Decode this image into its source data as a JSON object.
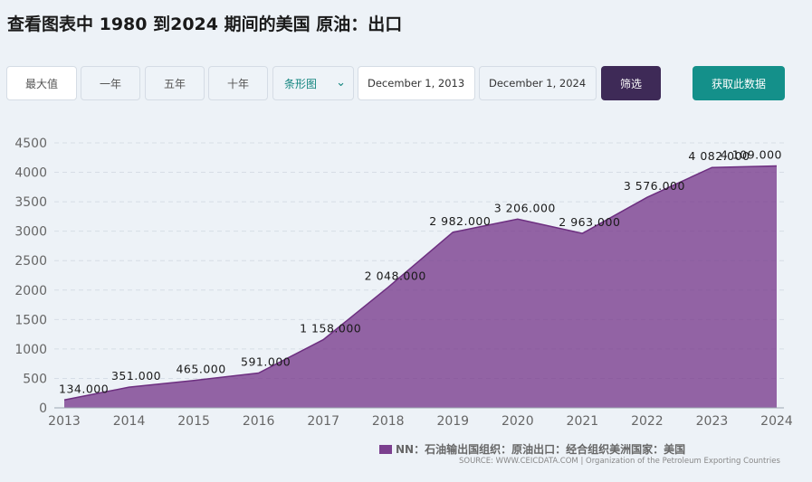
{
  "header": {
    "title": "查看图表中 1980 到2024 期间的美国 原油：出口"
  },
  "toolbar": {
    "range_buttons": [
      "最大值",
      "一年",
      "五年",
      "十年"
    ],
    "chart_type_value": "条形图",
    "date_from": "December 1, 2013",
    "date_to": "December 1, 2024",
    "filter_label": "筛选",
    "get_data_label": "获取此数据"
  },
  "colors": {
    "area": "#7b3f8e",
    "accent": "#14908a",
    "filter_button": "#3e2a57"
  },
  "legend": {
    "label": "NN：石油输出国组织：原油出口：经合组织美洲国家：美国"
  },
  "source": "SOURCE: WWW.CEICDATA.COM | Organization of the Petroleum Exporting Countries",
  "chart_data": {
    "type": "area",
    "x": [
      "2013",
      "2014",
      "2015",
      "2016",
      "2017",
      "2018",
      "2019",
      "2020",
      "2021",
      "2022",
      "2023",
      "2024"
    ],
    "series": [
      {
        "name": "NN：石油输出国组织：原油出口：经合组织美洲国家：美国",
        "values": [
          134,
          351,
          465,
          591,
          1158,
          2048,
          2982,
          3206,
          2963,
          3576,
          4082,
          4109
        ],
        "labels": [
          "134.000",
          "351.000",
          "465.000",
          "591.000",
          "1 158.000",
          "2 048.000",
          "2 982.000",
          "3 206.000",
          "2 963.000",
          "3 576.000",
          "4 082.000",
          "4 109.000"
        ]
      }
    ],
    "yticks": [
      "0",
      "500",
      "1000",
      "1500",
      "2000",
      "2500",
      "3000",
      "3500",
      "4000",
      "4500"
    ],
    "ylim": [
      0,
      4500
    ],
    "grid": true,
    "legend_position": "bottom-right"
  }
}
